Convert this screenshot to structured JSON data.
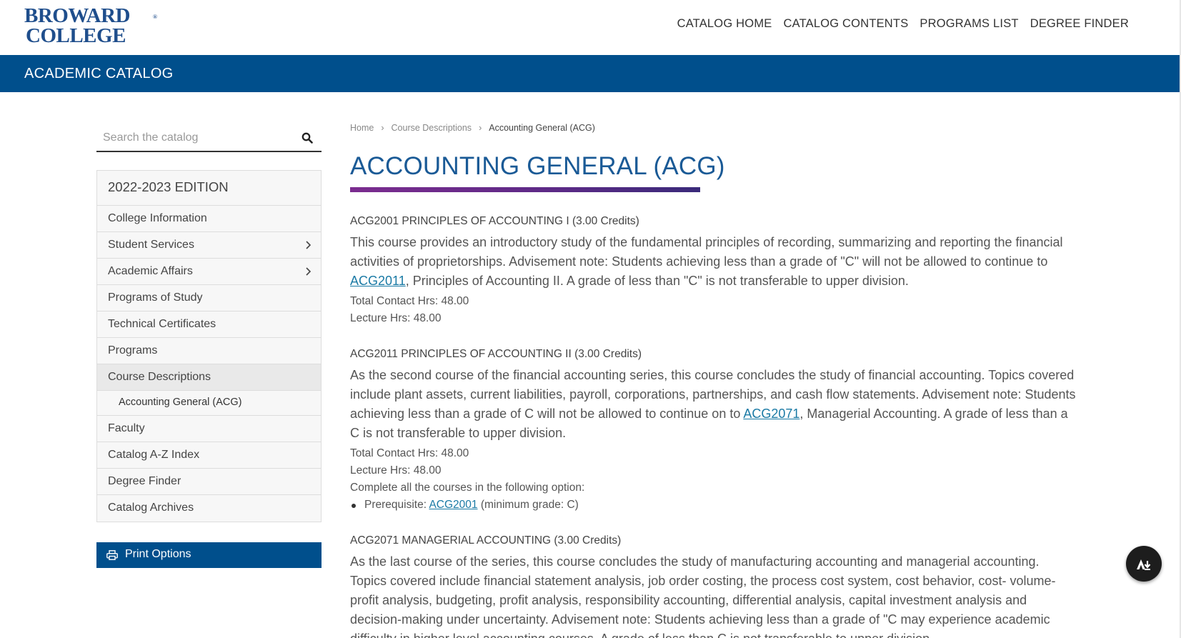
{
  "header": {
    "logo_line1": "BROWARD",
    "logo_line2": "COLLEGE",
    "logo_reg": "®",
    "nav": [
      "CATALOG HOME",
      "CATALOG CONTENTS",
      "PROGRAMS LIST",
      "DEGREE FINDER"
    ]
  },
  "catalog_bar": {
    "title": "ACADEMIC CATALOG"
  },
  "sidebar": {
    "search_placeholder": "Search the catalog",
    "edition": "2022-2023 EDITION",
    "items": [
      {
        "label": "College Information"
      },
      {
        "label": "Student Services"
      },
      {
        "label": "Academic Affairs"
      },
      {
        "label": "Programs of Study"
      },
      {
        "label": "Technical Certificates"
      },
      {
        "label": "Programs"
      },
      {
        "label": "Course Descriptions"
      },
      {
        "label": "Accounting General (ACG)"
      },
      {
        "label": "Faculty"
      },
      {
        "label": "Catalog A-Z Index"
      },
      {
        "label": "Degree Finder"
      },
      {
        "label": "Catalog Archives"
      }
    ],
    "print_label": "Print Options"
  },
  "breadcrumb": {
    "home": "Home",
    "sep": "›",
    "section": "Course Descriptions",
    "current": "Accounting General (ACG)"
  },
  "page_title": "ACCOUNTING GENERAL (ACG)",
  "courses": [
    {
      "head": "ACG2001  PRINCIPLES OF ACCOUNTING I  (3.00 Credits)",
      "desc_a": "This course provides an introductory study of the fundamental principles of recording, summarizing and reporting the financial activities of proprietorships. Advisement note: Students achieving less than a grade of \"C\" will not be allowed to continue to ",
      "desc_link": "ACG2011",
      "desc_b": ", Principles of Accounting II. A grade of less than \"C\" is not transferable to upper division.",
      "contact": "Total Contact Hrs: 48.00",
      "lecture": "Lecture Hrs: 48.00"
    },
    {
      "head": "ACG2011  PRINCIPLES OF ACCOUNTING II  (3.00 Credits)",
      "desc_a": "As the second course of the financial accounting series, this course concludes the study of financial accounting. Topics covered include plant assets, current liabilities, payroll, corporations, partnerships, and cash flow statements. Advisement note: Students achieving less than a grade of C will not be allowed to continue on to ",
      "desc_link": "ACG2071",
      "desc_b": ", Managerial Accounting. A grade of less than a C is not transferable to upper division.",
      "contact": "Total Contact Hrs: 48.00",
      "lecture": "Lecture Hrs: 48.00",
      "option_text": "Complete all the courses in the following option:",
      "prereq_label": "Prerequisite: ",
      "prereq_link": "ACG2001",
      "prereq_tail": " (minimum grade: C)"
    },
    {
      "head": "ACG2071  MANAGERIAL ACCOUNTING  (3.00 Credits)",
      "desc_a": "As the last course of the series, this course concludes the study of manufacturing accounting and managerial accounting. Topics covered include financial statement analysis, job order costing, the process cost system, cost behavior, cost- volume-profit analysis, budgeting, profit analysis, responsibility accounting, differential analysis, capital investment analysis and decision-making under uncertainty. Advisement note: Students achieving less than a grade of \"C may experience academic difficulty in higher level accounting courses. A grade of less than C is not transferable to upper division."
    }
  ],
  "icons": {
    "search": "search-icon",
    "chevron": "chevron-right-icon",
    "print": "printer-icon",
    "fab": "adobe-download-icon"
  },
  "colors": {
    "brand_blue": "#004f8c",
    "title_blue": "#1a5a96",
    "link": "#1a7aa5",
    "accent_purple": "#7b2c8f"
  }
}
